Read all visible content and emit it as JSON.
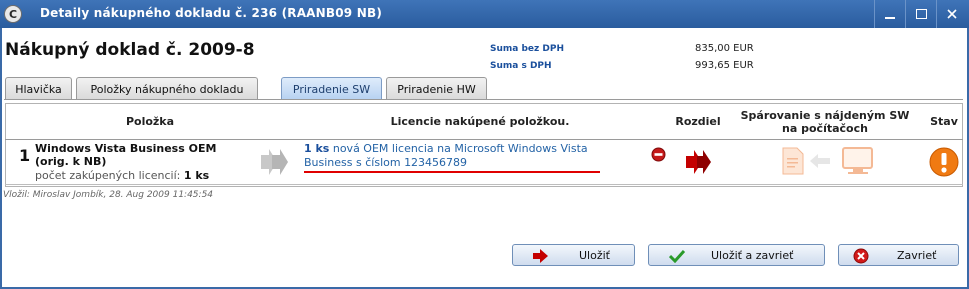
{
  "window": {
    "title": "Detaily nákupného dokladu č. 236 (RAANB09 NB)",
    "app_icon_letter": "C",
    "controls": [
      "minimize-icon",
      "maximize-icon",
      "close-icon"
    ]
  },
  "header": {
    "title": "Nákupný doklad č. 2009-8",
    "sums": [
      {
        "label": "Suma bez DPH",
        "value": "835,00 EUR"
      },
      {
        "label": "Suma s DPH",
        "value": "993,65 EUR"
      }
    ]
  },
  "tabs": [
    {
      "label": "Hlavička",
      "active": false
    },
    {
      "label": "Položky nákupného dokladu",
      "active": false
    },
    {
      "label": "Priradenie SW",
      "active": true
    },
    {
      "label": "Priradenie HW",
      "active": false
    }
  ],
  "table": {
    "columns": {
      "item": "Položka",
      "licenses": "Licencie nakúpené položkou.",
      "diff": "Rozdiel",
      "pairing": "Spárovanie s nájdeným SW na počítačoch",
      "status": "Stav"
    },
    "rows": [
      {
        "number": "1",
        "name": "Windows Vista Business OEM (orig. k NB)",
        "count_label": "počet zakúpených licencií:",
        "count_value": "1 ks",
        "license_qty": "1 ks",
        "license_text": "nová OEM licencia na Microsoft Windows Vista Business s číslom 123456789"
      }
    ]
  },
  "footer_note": "Vložil: Miroslav Jombík, 28. Aug 2009 11:45:54",
  "buttons": {
    "save": "Uložiť",
    "save_close": "Uložiť a zavrieť",
    "close": "Zavrieť"
  },
  "colors": {
    "titlebar": "#2f63a8",
    "link": "#2463a6",
    "diff_arrow": "#c40000",
    "status": "#f07a12"
  }
}
